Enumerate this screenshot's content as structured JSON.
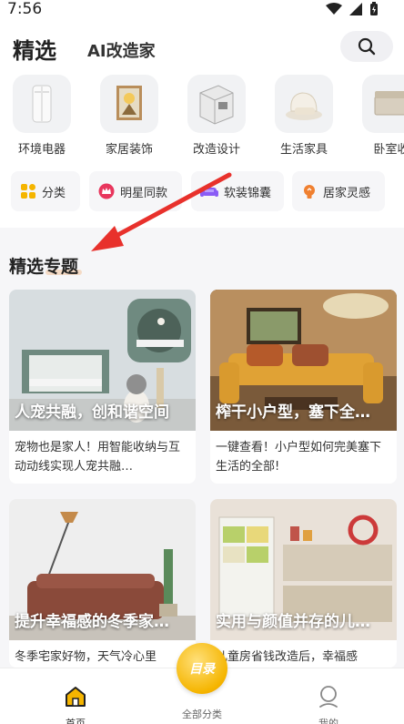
{
  "status_bar": {
    "time": "7:56"
  },
  "header": {
    "tab_selected": "精选",
    "tab_ai": "AI改造家"
  },
  "categories": [
    {
      "label": "环境电器",
      "icon": "air-purifier-icon"
    },
    {
      "label": "家居装饰",
      "icon": "picture-frame-icon"
    },
    {
      "label": "改造设计",
      "icon": "room-design-icon"
    },
    {
      "label": "生活家具",
      "icon": "chair-icon"
    },
    {
      "label": "卧室收",
      "icon": "storage-box-icon"
    }
  ],
  "chips": [
    {
      "label": "分类",
      "color": "#f5b500"
    },
    {
      "label": "明星同款",
      "color": "#e8365d"
    },
    {
      "label": "软装锦囊",
      "color": "#8a5cf6"
    },
    {
      "label": "居家灵感",
      "color": "#f08030"
    }
  ],
  "section": {
    "title": "精选专题"
  },
  "cards": [
    {
      "title": "人宠共融，创和谐空间",
      "desc": "宠物也是家人！用智能收纳与互动动线实现人宠共融…"
    },
    {
      "title": "榨干小户型，塞下全…",
      "desc": "一键查看！小户型如何完美塞下生活的全部!"
    },
    {
      "title": "提升幸福感的冬季家…",
      "desc": "冬季宅家好物，天气冷心里"
    },
    {
      "title": "实用与颜值并存的儿…",
      "desc": "儿童房省钱改造后，幸福感"
    }
  ],
  "bottom_nav": {
    "home": "首页",
    "all_categories": "全部分类",
    "center_badge": "目录",
    "mine": "我的"
  }
}
